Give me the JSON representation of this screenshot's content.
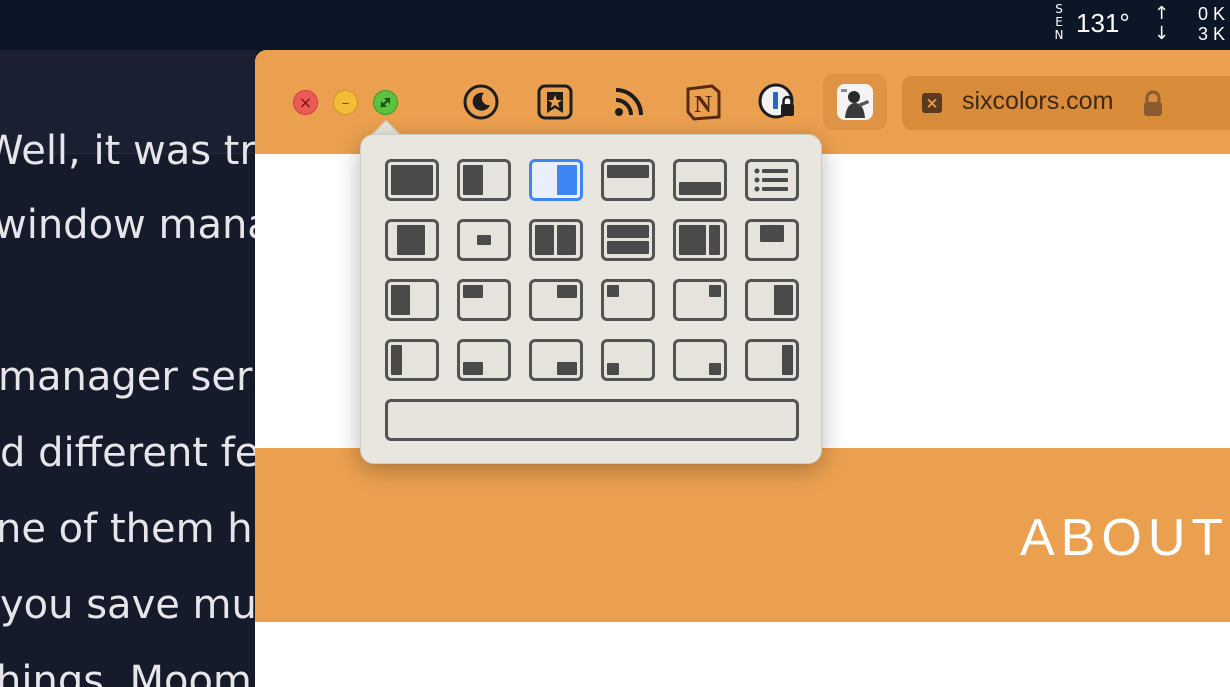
{
  "menubar": {
    "compass": [
      "S",
      "E",
      "N"
    ],
    "temperature": "131°",
    "net_up": "0 K",
    "net_down": "3 K"
  },
  "background_article": {
    "lines": [
      "Well, it was true",
      "window manager",
      "",
      "manager serial",
      "d different fea",
      "ne of them ha",
      "you save mult",
      "hings. Moom"
    ]
  },
  "browser": {
    "toolbar": {
      "close_icon": "close-icon",
      "minimize_icon": "minimize-icon",
      "zoom_icon": "zoom-icon",
      "extensions": [
        "moon-icon",
        "bookmark-star-icon",
        "rss-icon",
        "notion-icon",
        "onepassword-icon"
      ],
      "url": "sixcolors.com"
    },
    "page": {
      "about_heading": "ABOUT"
    },
    "colors": {
      "brand_orange": "#eba04f",
      "selected_blue": "#3f86f5"
    }
  },
  "moom": {
    "selected_tile": "right-half",
    "tiles": [
      "full-screen",
      "left-half",
      "right-half",
      "top-half",
      "bottom-half",
      "list",
      "center-large",
      "center-small",
      "two-columns",
      "two-rows",
      "left-two-thirds",
      "top-center",
      "left-third",
      "top-left",
      "top-right",
      "top-left-small",
      "top-right-small",
      "right-third",
      "left-sixth",
      "bottom-left",
      "bottom-right",
      "bottom-left-small",
      "bottom-right-small",
      "right-sixth"
    ],
    "command_input": ""
  }
}
